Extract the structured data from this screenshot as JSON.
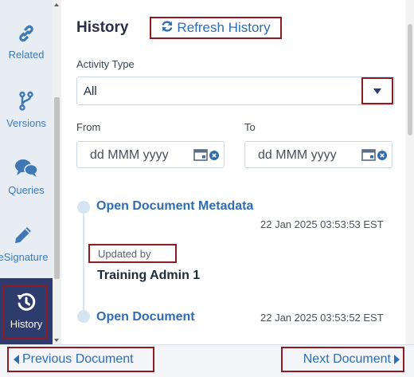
{
  "sidebar": {
    "items": [
      {
        "label": "Related",
        "icon": "link-icon"
      },
      {
        "label": "Versions",
        "icon": "branch-icon"
      },
      {
        "label": "Queries",
        "icon": "chat-icon"
      },
      {
        "label": "eSignature",
        "icon": "pen-icon"
      },
      {
        "label": "History",
        "icon": "history-icon",
        "active": true
      }
    ]
  },
  "panel": {
    "title": "History",
    "refresh_label": "Refresh History"
  },
  "filters": {
    "activity_type_label": "Activity Type",
    "activity_type_value": "All",
    "from_label": "From",
    "to_label": "To",
    "from_placeholder": "dd MMM yyyy",
    "to_placeholder": "dd MMM yyyy"
  },
  "events": [
    {
      "title": "Open Document Metadata",
      "time": "22 Jan 2025 03:53:53 EST",
      "updated_by_label": "Updated by",
      "updated_by": "Training Admin 1"
    },
    {
      "title": "Open Document",
      "time": "22 Jan 2025 03:53:52 EST"
    }
  ],
  "nav": {
    "prev_label": "Previous Document",
    "next_label": "Next Document"
  },
  "colors": {
    "accent": "#2f6db0",
    "highlight_border": "#8c1b22",
    "active_tab": "#2d3c6c"
  }
}
